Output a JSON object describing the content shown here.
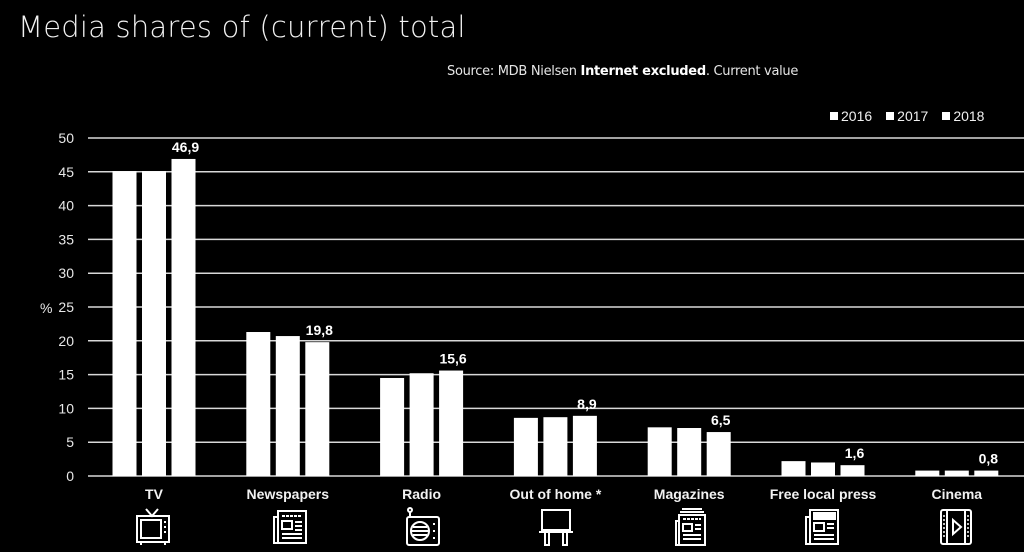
{
  "title": "Media shares of (current) total",
  "source": {
    "prefix": "Source: MDB Nielsen ",
    "bold": "Internet excluded",
    "suffix": ". Current value"
  },
  "chart_data": {
    "type": "bar",
    "title": "Media shares of (current) total",
    "xlabel": "",
    "ylabel": "%",
    "ylim": [
      0,
      50
    ],
    "yticks": [
      0,
      5,
      10,
      15,
      20,
      25,
      30,
      35,
      40,
      45,
      50
    ],
    "grid": true,
    "legend_position": "top-right",
    "categories": [
      "TV",
      "Newspapers",
      "Radio",
      "Out of home *",
      "Magazines",
      "Free local press",
      "Cinema"
    ],
    "series": [
      {
        "name": "2016",
        "color": "#ffffff",
        "values": [
          45.1,
          21.3,
          14.5,
          8.6,
          7.2,
          2.2,
          0.8
        ]
      },
      {
        "name": "2017",
        "color": "#ffffff",
        "values": [
          45.1,
          20.7,
          15.2,
          8.7,
          7.1,
          2.0,
          0.8
        ]
      },
      {
        "name": "2018",
        "color": "#ffffff",
        "values": [
          46.9,
          19.8,
          15.6,
          8.9,
          6.5,
          1.6,
          0.8
        ]
      }
    ],
    "data_labels": {
      "series": "2018",
      "labels": [
        "46,9",
        "19,8",
        "15,6",
        "8,9",
        "6,5",
        "1,6",
        "0,8"
      ]
    },
    "category_icons": [
      "tv-icon",
      "newspaper-icon",
      "radio-icon",
      "billboard-icon",
      "magazine-icon",
      "free-press-icon",
      "cinema-icon"
    ]
  },
  "colors": {
    "background": "#000000",
    "bars": "#ffffff",
    "gridlines": "#d9d9d9",
    "text": "#f2f2f2"
  }
}
